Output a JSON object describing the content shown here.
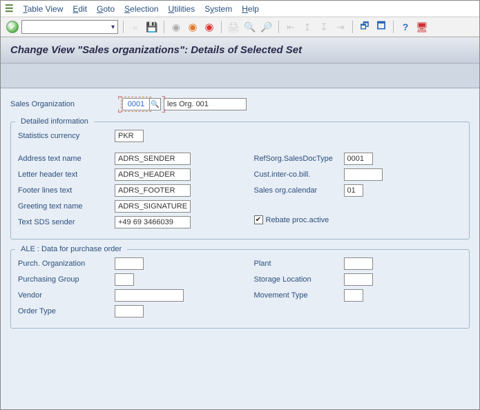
{
  "menu": {
    "table_view": "Table View",
    "edit": "Edit",
    "goto": "Goto",
    "selection": "Selection",
    "utilities": "Utilities",
    "system": "System",
    "help": "Help"
  },
  "title": "Change View \"Sales organizations\": Details of Selected Set",
  "header": {
    "sales_org_label": "Sales Organization",
    "sales_org_code": "0001",
    "sales_org_desc": "les Org. 001"
  },
  "group_detail": {
    "title": "Detailed information",
    "stat_currency_label": "Statistics currency",
    "stat_currency": "PKR",
    "address_text_name_label": "Address text name",
    "address_text_name": "ADRS_SENDER",
    "letter_header_label": "Letter header text",
    "letter_header": "ADRS_HEADER",
    "footer_lines_label": "Footer lines text",
    "footer_lines": "ADRS_FOOTER",
    "greeting_text_label": "Greeting text name",
    "greeting_text": "ADRS_SIGNATURE",
    "text_sds_label": "Text SDS sender",
    "text_sds": "+49 69 3466039",
    "ref_sorg_label": "RefSorg.SalesDocType",
    "ref_sorg": "0001",
    "cust_inter_label": "Cust.inter-co.bill.",
    "cust_inter": "",
    "sales_org_cal_label": "Sales org.calendar",
    "sales_org_cal": "01",
    "rebate_label": "Rebate proc.active",
    "rebate_checked": true
  },
  "group_ale": {
    "title": "ALE : Data for purchase order",
    "purch_org_label": "Purch. Organization",
    "purch_org": "",
    "purch_group_label": "Purchasing Group",
    "purch_group": "",
    "vendor_label": "Vendor",
    "vendor": "",
    "order_type_label": "Order Type",
    "order_type": "",
    "plant_label": "Plant",
    "plant": "",
    "storage_loc_label": "Storage Location",
    "storage_loc": "",
    "movement_type_label": "Movement Type",
    "movement_type": ""
  }
}
